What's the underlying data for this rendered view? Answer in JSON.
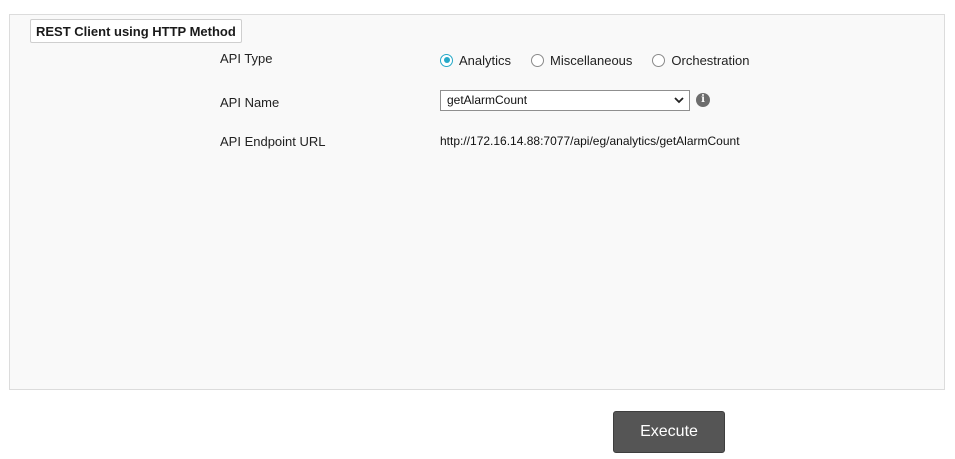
{
  "panel": {
    "title": "REST Client using HTTP Method"
  },
  "form": {
    "api_type": {
      "label": "API Type",
      "options": [
        {
          "label": "Analytics",
          "checked": true
        },
        {
          "label": "Miscellaneous",
          "checked": false
        },
        {
          "label": "Orchestration",
          "checked": false
        }
      ]
    },
    "api_name": {
      "label": "API Name",
      "selected": "getAlarmCount",
      "info_icon": "info-icon"
    },
    "api_endpoint": {
      "label": "API Endpoint URL",
      "value": "http://172.16.14.88:7077/api/eg/analytics/getAlarmCount"
    }
  },
  "actions": {
    "execute_label": "Execute"
  },
  "colors": {
    "radio_accent": "#26a9c8",
    "button_bg": "#555555"
  }
}
